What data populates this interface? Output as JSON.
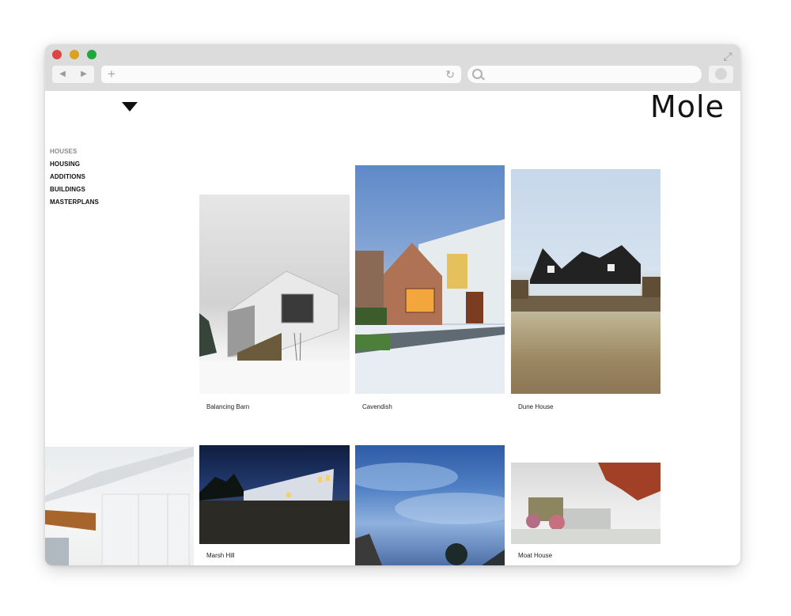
{
  "browser": {
    "back_glyph": "◀",
    "forward_glyph": "▶",
    "newtab_glyph": "+",
    "reload_glyph": "↻",
    "expand_glyph": "⤢",
    "traffic_colors": {
      "close": "#e0443e",
      "minimize": "#dca123",
      "zoom": "#1ea83a"
    }
  },
  "site": {
    "logo": "Mole",
    "menu_toggle_icon": "triangle-down-icon"
  },
  "nav": {
    "items": [
      "HOUSES",
      "HOUSING",
      "ADDITIONS",
      "BUILDINGS",
      "MASTERPLANS"
    ],
    "active": "HOUSES"
  },
  "projects": [
    {
      "title": "Balancing Barn"
    },
    {
      "title": "Cavendish"
    },
    {
      "title": "Dune House"
    },
    {
      "title": ""
    },
    {
      "title": "Marsh Hill"
    },
    {
      "title": ""
    },
    {
      "title": "Moat House"
    }
  ]
}
